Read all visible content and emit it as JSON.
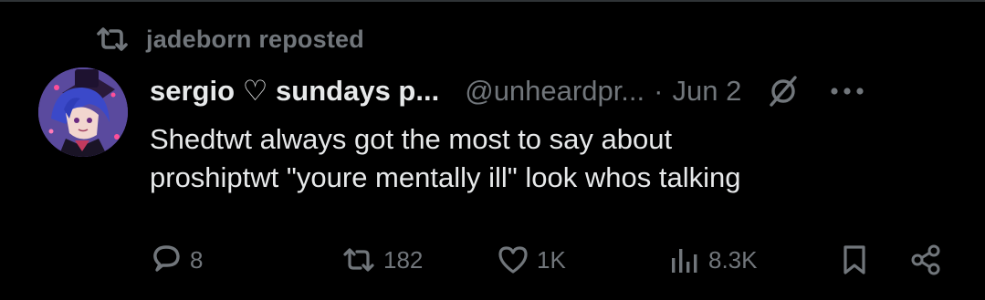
{
  "repost": {
    "icon": "repost-icon",
    "text": "jadeborn reposted"
  },
  "post": {
    "avatar": "avatar",
    "display_name": "sergio ♡ sundays p...",
    "handle": "@unheardpr...",
    "separator": "·",
    "date": "Jun 2",
    "text_lines": [
      "Shedtwt always got the most to say about",
      "proshiptwt \"youre mentally ill\" look whos talking"
    ]
  },
  "actions": {
    "replies": "8",
    "reposts": "182",
    "likes": "1K",
    "views": "8.3K"
  },
  "colors": {
    "background": "#000000",
    "primary_text": "#e7e9ea",
    "secondary_text": "#71767b",
    "divider": "#2f3336"
  }
}
